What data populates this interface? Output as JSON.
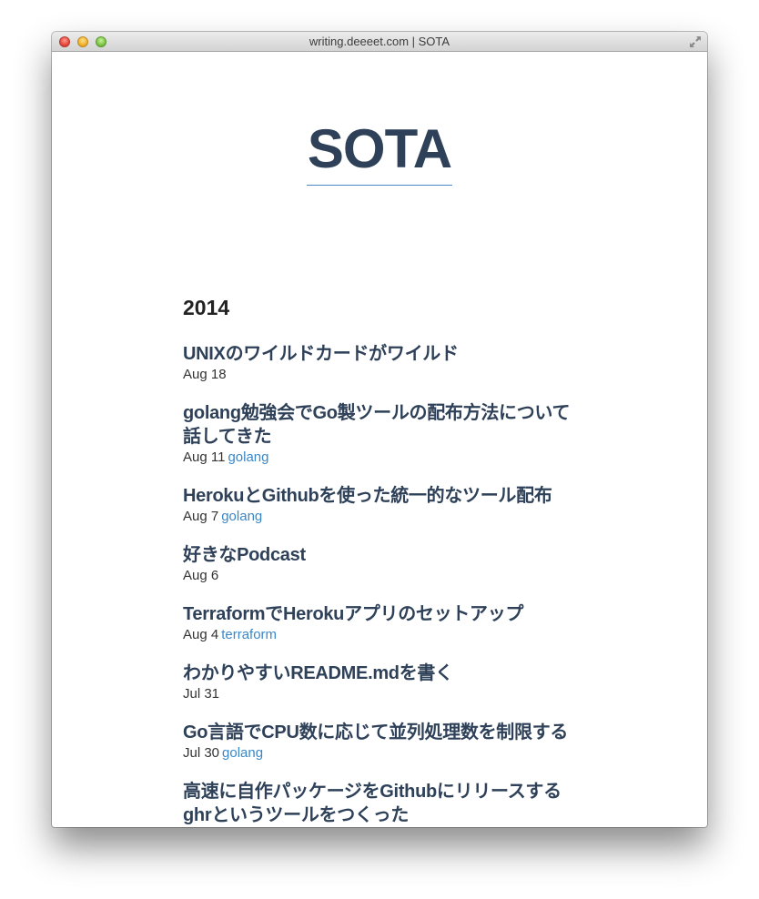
{
  "window": {
    "title": "writing.deeeet.com | SOTA"
  },
  "site": {
    "title": "SOTA",
    "year": "2014"
  },
  "posts": [
    {
      "title": "UNIXのワイルドカードがワイルド",
      "date": "Aug 18",
      "tag": ""
    },
    {
      "title": "golang勉強会でGo製ツールの配布方法について話してきた",
      "date": "Aug 11",
      "tag": "golang"
    },
    {
      "title": "HerokuとGithubを使った統一的なツール配布",
      "date": "Aug 7",
      "tag": "golang"
    },
    {
      "title": "好きなPodcast",
      "date": "Aug 6",
      "tag": ""
    },
    {
      "title": "TerraformでHerokuアプリのセットアップ",
      "date": "Aug 4",
      "tag": "terraform"
    },
    {
      "title": "わかりやすいREADME.mdを書く",
      "date": "Jul 31",
      "tag": ""
    },
    {
      "title": "Go言語でCPU数に応じて並列処理数を制限する",
      "date": "Jul 30",
      "tag": "golang"
    },
    {
      "title": "高速に自作パッケージをGithubにリリースするghrというツールをつくった",
      "date": "",
      "tag": ""
    }
  ],
  "colors": {
    "title": "#2e4159",
    "link": "#3a87c9",
    "underline": "#4a89c8"
  },
  "icons": {
    "close": "close-button-icon",
    "minimize": "minimize-button-icon",
    "zoom": "zoom-button-icon",
    "fullscreen": "fullscreen-icon"
  }
}
